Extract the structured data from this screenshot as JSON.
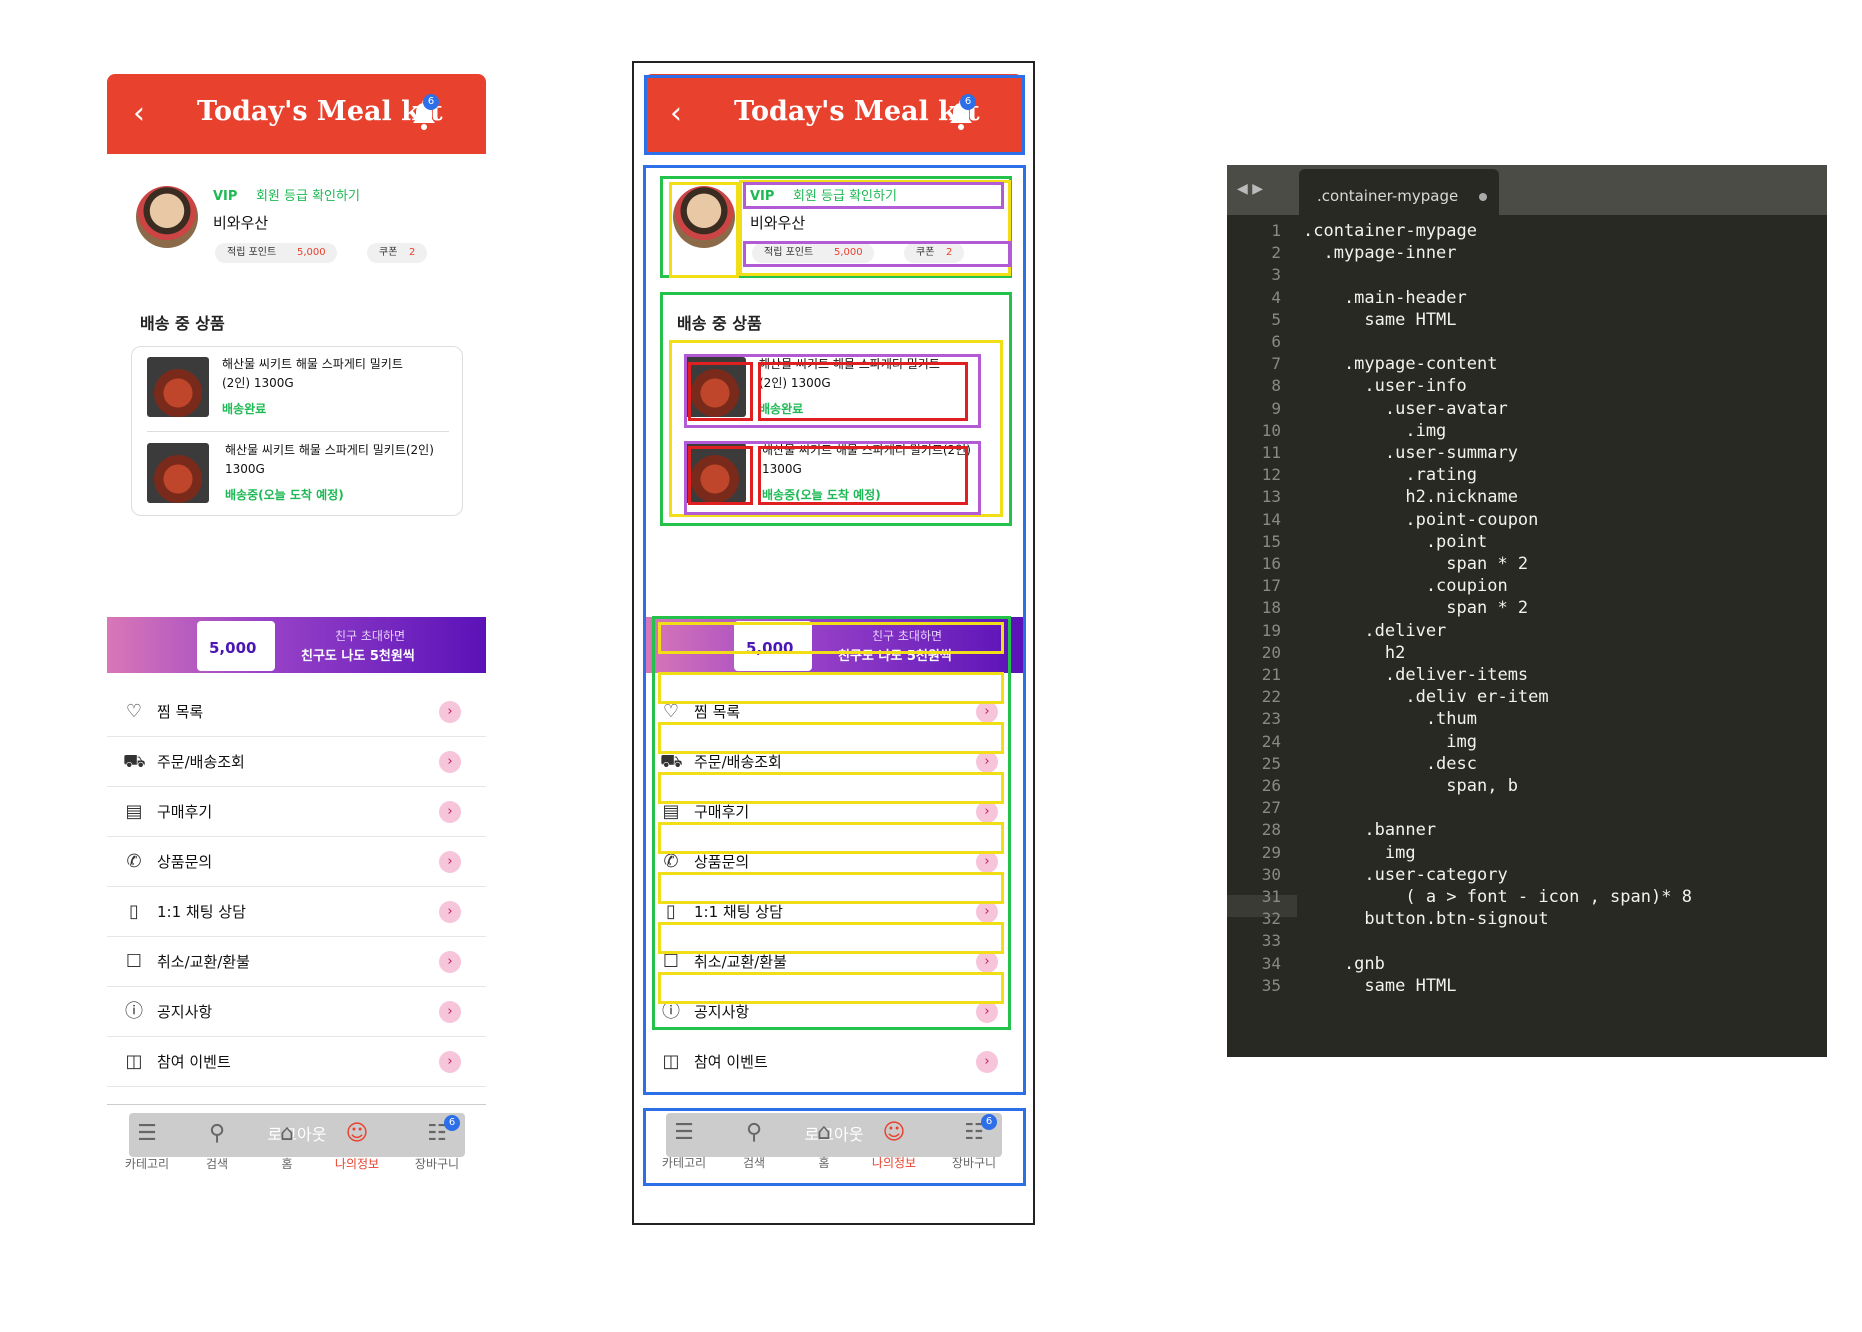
{
  "app": {
    "title": "Today's Meal kit",
    "back_icon": "chevron-left-icon",
    "notification_icon": "bell-icon",
    "notification_count": "6"
  },
  "user": {
    "rating": "VIP",
    "rating_link": "회원 등급 확인하기",
    "nickname": "비와우산",
    "point_label": "적립 포인트",
    "point_value": "5,000",
    "coupon_label": "쿠폰",
    "coupon_value": "2"
  },
  "deliver": {
    "title": "배송 중 상품",
    "items": [
      {
        "name": "해산물 씨키트 해물 스파게티 밀키트",
        "name2": "(2인) 1300G",
        "status": "배송완료"
      },
      {
        "name": "해산물 씨키트 해물 스파게티 밀키트(2인)",
        "name2": "1300G",
        "status": "배송중(오늘 도착 예정)"
      }
    ]
  },
  "banner": {
    "amount": "5,000",
    "line1": "친구 초대하면",
    "line2": "친구도 나도 5천원씩"
  },
  "categories": [
    {
      "label": "찜 목록",
      "icon": "heart-icon"
    },
    {
      "label": "주문/배송조회",
      "icon": "truck-icon"
    },
    {
      "label": "구매후기",
      "icon": "review-icon"
    },
    {
      "label": "상품문의",
      "icon": "phone-icon"
    },
    {
      "label": "1:1 채팅 상담",
      "icon": "mobile-chat-icon"
    },
    {
      "label": "취소/교환/환불",
      "icon": "box-icon"
    },
    {
      "label": "공지사항",
      "icon": "alert-icon"
    },
    {
      "label": "참여 이벤트",
      "icon": "gift-icon"
    }
  ],
  "logout_label": "로그아웃",
  "gnb": [
    {
      "label": "카테고리",
      "icon": "menu-icon"
    },
    {
      "label": "검색",
      "icon": "search-icon"
    },
    {
      "label": "홈",
      "icon": "home-icon"
    },
    {
      "label": "나의정보",
      "icon": "user-icon",
      "active": true
    },
    {
      "label": "장바구니",
      "icon": "cart-icon",
      "badge": "6"
    }
  ],
  "colors": {
    "brand": "#e8412e",
    "accent_green": "#1db954",
    "overlay_blue": "#2d6fe8",
    "overlay_green": "#24c24a",
    "overlay_yellow": "#f2de17",
    "overlay_purple": "#b35bd6",
    "overlay_red": "#e02020"
  },
  "editor": {
    "tab_title": ".container-mypage",
    "lines": [
      ".container-mypage",
      "  .mypage-inner",
      "",
      "    .main-header",
      "      same HTML",
      "",
      "    .mypage-content",
      "      .user-info",
      "        .user-avatar",
      "          .img",
      "        .user-summary",
      "          .rating",
      "          h2.nickname",
      "          .point-coupon",
      "            .point",
      "              span * 2",
      "            .coupion",
      "              span * 2",
      "      .deliver",
      "        h2",
      "        .deliver-items",
      "          .deliv er-item",
      "            .thum",
      "              img",
      "            .desc",
      "              span, b",
      "",
      "      .banner",
      "        img",
      "      .user-category",
      "          ( a > font - icon , span)* 8",
      "      button.btn-signout",
      "",
      "    .gnb",
      "      same HTML"
    ]
  }
}
